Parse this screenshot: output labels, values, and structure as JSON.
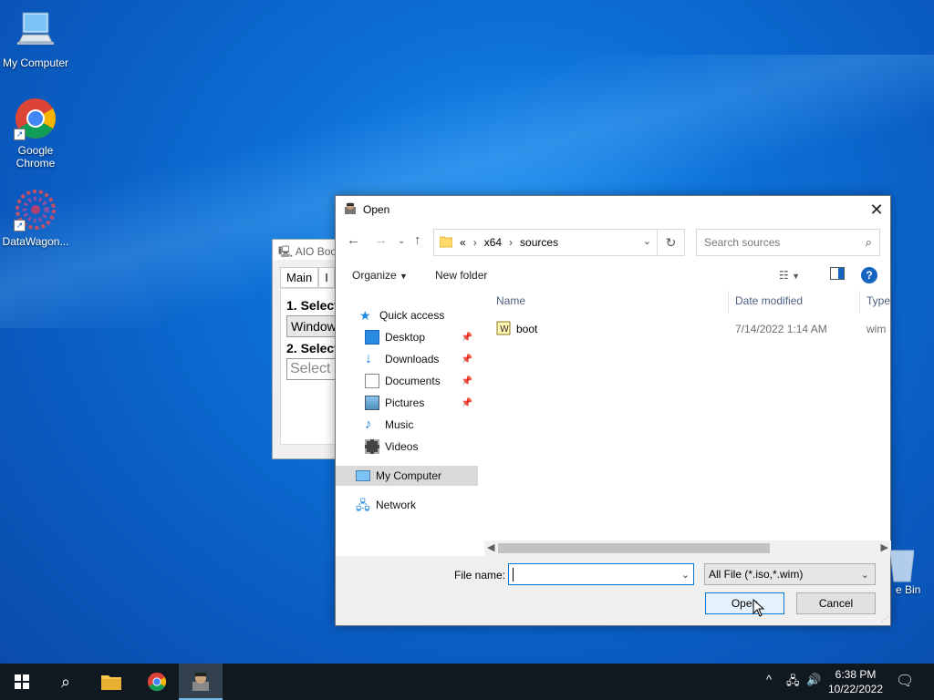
{
  "desktop": {
    "icons": [
      {
        "label": "My Computer",
        "icon": "computer-icon"
      },
      {
        "label": "Google Chrome",
        "icon": "chrome-icon"
      },
      {
        "label": "DataWagon...",
        "icon": "datawagon-icon"
      }
    ],
    "recycle_bin_label": "e Bin"
  },
  "aio_window": {
    "title": "AIO Boo",
    "tabs": [
      "Main",
      "I"
    ],
    "step1": "1. Select",
    "step1_value": "Windows",
    "step2": "2. Select",
    "step2_placeholder": "Select I"
  },
  "dialog": {
    "title": "Open",
    "address": {
      "overflow": "«",
      "crumbs": [
        "x64",
        "sources"
      ]
    },
    "search_placeholder": "Search sources",
    "toolbar": {
      "organize": "Organize",
      "new_folder": "New folder"
    },
    "nav": {
      "quick_access": "Quick access",
      "items": [
        {
          "label": "Desktop",
          "pinned": true
        },
        {
          "label": "Downloads",
          "pinned": true
        },
        {
          "label": "Documents",
          "pinned": true
        },
        {
          "label": "Pictures",
          "pinned": true
        },
        {
          "label": "Music",
          "pinned": false
        },
        {
          "label": "Videos",
          "pinned": false
        }
      ],
      "my_computer": "My Computer",
      "network": "Network"
    },
    "columns": {
      "name": "Name",
      "date": "Date modified",
      "type": "Type"
    },
    "files": [
      {
        "name": "boot",
        "date": "7/14/2022 1:14 AM",
        "type": "wim"
      }
    ],
    "file_name_label": "File name:",
    "file_name_value": "",
    "filter": "All File (*.iso,*.wim)",
    "open_button": "Open",
    "cancel_button": "Cancel"
  },
  "taskbar": {
    "time": "6:38 PM",
    "date": "10/22/2022"
  },
  "colors": {
    "accent": "#0078d7",
    "taskbar": "#101820"
  }
}
